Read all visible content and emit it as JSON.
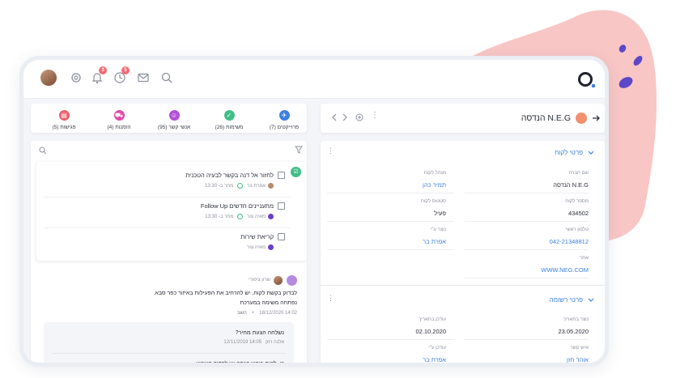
{
  "colors": {
    "accent": "#3d7fe0",
    "blob": "#f8c6c5",
    "blob_dots": "#5b47c7",
    "badge": "#f46b72"
  },
  "topbar": {
    "icons": [
      "user-avatar",
      "gear-icon",
      "bell-icon",
      "clock-icon",
      "mail-icon",
      "search-icon"
    ],
    "badges": {
      "bell": "3",
      "clock": "5"
    }
  },
  "categories": [
    {
      "label": "פרוייקטים (7)",
      "color": "#3d7fe0",
      "icon": "rocket-icon"
    },
    {
      "label": "משימות (26)",
      "color": "#3fbf86",
      "icon": "check-icon"
    },
    {
      "label": "אנשי קשר (95)",
      "color": "#b34fd8",
      "icon": "contact-icon"
    },
    {
      "label": "הזמנות (4)",
      "color": "#e04aa8",
      "icon": "cart-icon"
    },
    {
      "label": "פגישות (5)",
      "color": "#ea5f6b",
      "icon": "calendar-icon"
    }
  ],
  "entity": {
    "title": "N.E.G הנדסה"
  },
  "customer": {
    "section_title": "פרטי לקוח",
    "company_label": "שם חברה",
    "company": "N.E.G הנדסה",
    "manager_label": "מנהל לקוח",
    "manager": "תמיר כהן",
    "number_label": "מספר לקוח",
    "number": "434502",
    "status_label": "סטטוס לקוח",
    "status": "פעיל",
    "phone_label": "טלפון ראשי",
    "phone": "042-21348812",
    "creator_label": "נוצר ע\"י",
    "creator": "אפרת בר",
    "site_label": "אתר",
    "site": "WWW.NEG.COM"
  },
  "record": {
    "section_title": "פרטי רשומה",
    "created_label": "נוצר בתאריך",
    "created": "23.05.2020",
    "updated_label": "עודכן בתאריך",
    "updated": "02.10.2020",
    "contact_label": "איש קשר",
    "contact": "אוהד חזן",
    "updatedby_label": "עודכן ע\"י",
    "updatedby": "אפרת בר"
  },
  "tasks": [
    {
      "title": "לחזור אל דנה בקשר לבעיה הטכנית",
      "assignee": "אפרת בר",
      "due": "מחר ב- 13:30"
    },
    {
      "title": "מתעניינים חדשים Follow Up",
      "assignee": "מאיה צור",
      "due": "מחר ב- 13:30"
    },
    {
      "title": "קריאת שירות",
      "assignee": "מאיה צור",
      "due": ""
    }
  ],
  "note": {
    "author": "שרון ציפורי",
    "text_line1": "לבדוק בקשת לקוח, יש להרחיב את הפעילות באיזור כפר סבא.",
    "text_line2": "נפתחה משימה במערכת",
    "timestamp": "14:02 18/12/2020",
    "reply": "השב"
  },
  "subnotes": [
    {
      "title": "נשלחה הצעת מחיר?",
      "author": "אלנה רוזן",
      "timestamp": "14:05 12/11/2019"
    },
    {
      "title": "כן, לקוח ביקש הנחה יש לבדוק השבוע"
    }
  ]
}
